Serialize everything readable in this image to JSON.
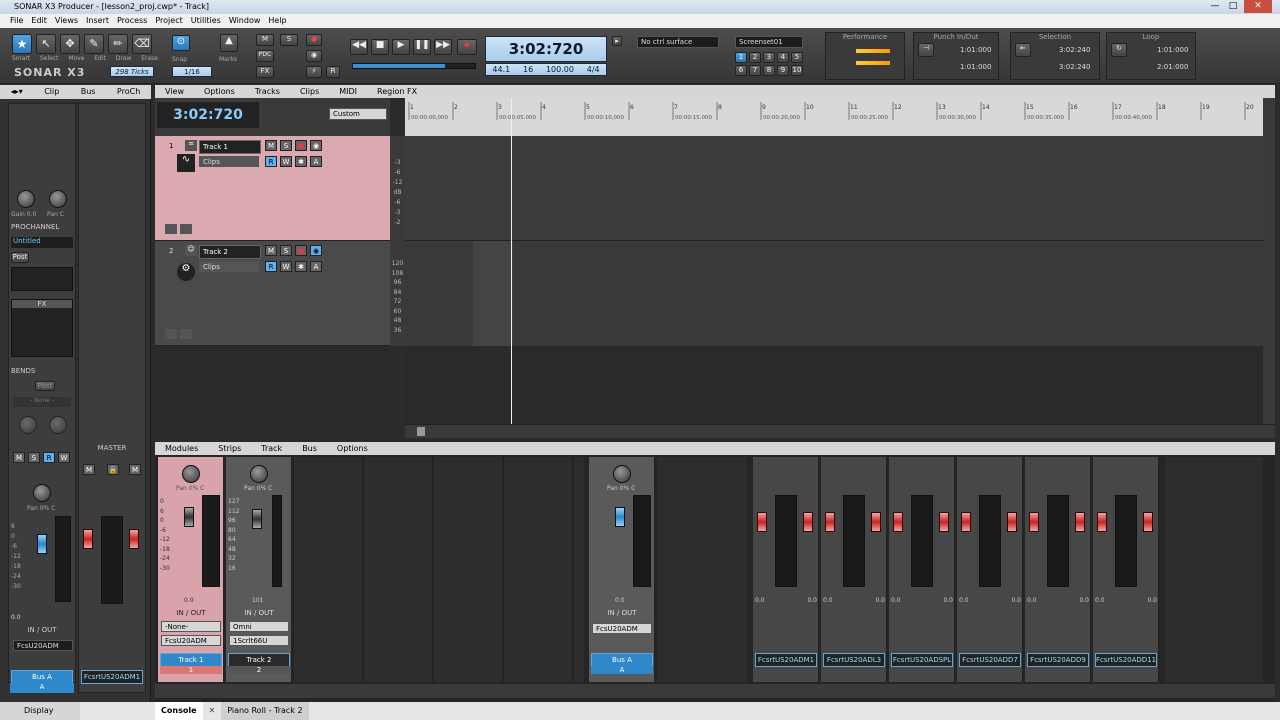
{
  "window": {
    "title": "SONAR X3 Producer - [lesson2_proj.cwp* - Track]",
    "min": "—",
    "max": "□",
    "close": "✕"
  },
  "menu": [
    "File",
    "Edit",
    "Views",
    "Insert",
    "Process",
    "Project",
    "Utilities",
    "Window",
    "Help"
  ],
  "control_bar": {
    "logo": "SONAR X3",
    "tools": [
      "Smart",
      "Select",
      "Move",
      "Edit",
      "Draw",
      "Erase"
    ],
    "ticks_label": "298 Ticks",
    "snap_label": "Snap",
    "snap_value": "1/16",
    "marks_label": "Marks",
    "mix_btns": [
      "M",
      "S",
      "PDC",
      "FX"
    ],
    "time_big": "3:02:720",
    "sample_rate": "44.1",
    "bit_depth": "16",
    "tempo": "100.00",
    "meter": "4/4",
    "ctrl_surface": "No ctrl surface",
    "screenset": "Screenset01",
    "screenset_nums": [
      "1",
      "2",
      "3",
      "4",
      "5",
      "6",
      "7",
      "8",
      "9",
      "10"
    ],
    "performance_label": "Performance",
    "punch_label": "Punch In/Out",
    "punch_in": "1:01:000",
    "punch_out": "1:01:000",
    "selection_label": "Selection",
    "sel_start": "3:02:240",
    "sel_end": "3:02:240",
    "loop_label": "Loop",
    "loop_start": "1:01:000",
    "loop_end": "2:01:000"
  },
  "inspector": {
    "tabs": [
      "Clip",
      "Bus",
      "ProCh"
    ],
    "gain_label": "Gain",
    "gain_val": "0.0",
    "pan_label": "Pan",
    "pan_val": "C",
    "prochannel": "PROCHANNEL",
    "preset": "Untitled",
    "post": "Post",
    "fx": "FX",
    "bends": "BENDS",
    "bends_post": "Post",
    "bends_none": "- None -",
    "msrw": [
      "M",
      "S",
      "R",
      "W"
    ],
    "pan_bottom": "Pan",
    "pan_bottom_val": "0% C",
    "scale": [
      "6",
      "0",
      "-6",
      "-12",
      "-18",
      "-24",
      "-30"
    ],
    "vol_val": "0.0",
    "io_label": "IN / OUT",
    "io_out": "FcsU20ADM",
    "bus_a": "Bus A",
    "bus_a_sub": "A",
    "master": "MASTER",
    "master_out": "FcsrtUS20ADM1",
    "display_label": "Display"
  },
  "track_view": {
    "menus": [
      "View",
      "Options",
      "Tracks",
      "Clips",
      "MIDI",
      "Region FX"
    ],
    "now_time": "3:02:720",
    "custom": "Custom",
    "tracks": [
      {
        "num": "1",
        "name": "Track 1",
        "clips": "Clips",
        "scale": [
          "-3",
          "-6",
          "-12",
          "dB",
          "-6",
          "-3",
          "-2"
        ]
      },
      {
        "num": "2",
        "name": "Track 2",
        "clips": "Clips",
        "scale": [
          "120",
          "108",
          "96",
          "84",
          "72",
          "60",
          "48",
          "36"
        ]
      }
    ],
    "ruler_bars": [
      "1",
      "2",
      "3",
      "4",
      "5",
      "6",
      "7",
      "8",
      "9",
      "10",
      "11",
      "12",
      "13",
      "14",
      "15",
      "16",
      "17",
      "18",
      "19",
      "20"
    ],
    "ruler_times": [
      "00:00:00,000",
      "00:00:05,000",
      "00:00:10,000",
      "00:00:15,000",
      "00:00:20,000",
      "00:00:25,000",
      "00:00:30,000",
      "00:00:35,000",
      "00:00:40,000"
    ]
  },
  "console": {
    "menus": [
      "Modules",
      "Strips",
      "Track",
      "Bus",
      "Options"
    ],
    "strips": [
      {
        "name": "Track 1",
        "num": "1",
        "pan": "Pan",
        "pan_val": "0% C",
        "vol": "0.0",
        "io": "IN / OUT",
        "in": "-None-",
        "out": "FcsU20ADM"
      },
      {
        "name": "Track 2",
        "num": "2",
        "pan": "Pan",
        "pan_val": "0% C",
        "vol": "101",
        "io": "IN / OUT",
        "in": "Omni",
        "out": "1Scrlt66U"
      }
    ],
    "strip_scale": [
      "0",
      "6",
      "0",
      "-6",
      "-12",
      "-18",
      "-24",
      "-30"
    ],
    "strip2_scale": [
      "127",
      "112",
      "96",
      "80",
      "64",
      "48",
      "32",
      "16"
    ],
    "bus": {
      "name": "Bus A",
      "sub": "A",
      "pan": "Pan",
      "pan_val": "0% C",
      "vol": "0.0",
      "io": "IN / OUT",
      "out": "FcsU20ADM"
    },
    "masters": [
      "FcsrtUS20ADM1",
      "FcsrtUS20ADL3",
      "FcsrtUS20ADSPL",
      "FcsrtUS20ADD7",
      "FcsrtUS20ADD9",
      "FcsrtUS20ADD11"
    ],
    "master_val": "0.0"
  },
  "bottom_tabs": [
    "Console",
    "Piano Roll - Track 2"
  ]
}
